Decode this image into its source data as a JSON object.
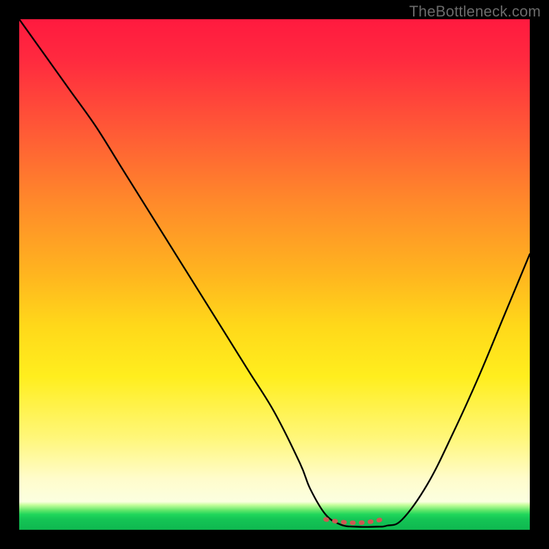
{
  "watermark": "TheBottleneck.com",
  "chart_data": {
    "type": "line",
    "title": "",
    "xlabel": "",
    "ylabel": "",
    "xlim": [
      0,
      100
    ],
    "ylim": [
      0,
      100
    ],
    "series": [
      {
        "name": "bottleneck-curve",
        "x": [
          0,
          5,
          10,
          15,
          20,
          25,
          30,
          35,
          40,
          45,
          50,
          55,
          57,
          60,
          63,
          66,
          70,
          72,
          75,
          80,
          85,
          90,
          95,
          100
        ],
        "values": [
          100,
          93,
          86,
          79,
          71,
          63,
          55,
          47,
          39,
          31,
          23,
          13,
          8,
          3,
          1,
          0.6,
          0.6,
          0.8,
          2,
          9,
          19,
          30,
          42,
          54
        ]
      }
    ],
    "annotations": [
      {
        "name": "optimal-zone",
        "x_start": 60,
        "x_end": 72,
        "style": "dotted-red"
      }
    ],
    "gradient_stops": [
      {
        "pct": 0,
        "color": "#ff1a3f"
      },
      {
        "pct": 50,
        "color": "#ffb51f"
      },
      {
        "pct": 70,
        "color": "#ffee1e"
      },
      {
        "pct": 92,
        "color": "#fffccb"
      },
      {
        "pct": 97,
        "color": "#1fd65b"
      },
      {
        "pct": 100,
        "color": "#0fb850"
      }
    ]
  }
}
